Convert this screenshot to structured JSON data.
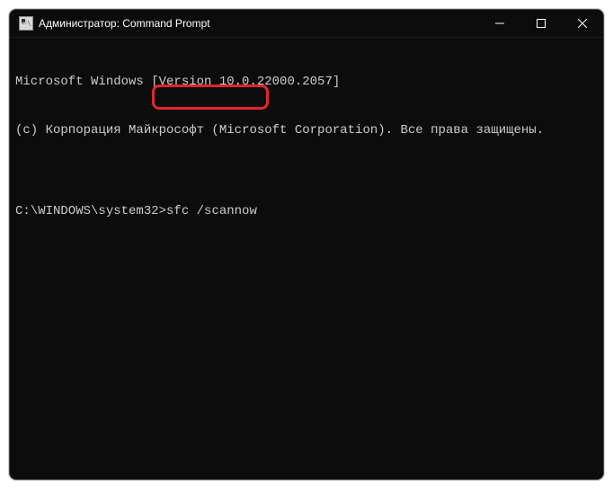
{
  "window": {
    "title": "Администратор: Command Prompt"
  },
  "terminal": {
    "line1": "Microsoft Windows [Version 10.0.22000.2057]",
    "line2": "(c) Корпорация Майкрософт (Microsoft Corporation). Все права защищены.",
    "blank": "",
    "prompt": "C:\\WINDOWS\\system32>",
    "command": "sfc /scannow"
  },
  "highlight": {
    "color": "#e0262e"
  }
}
